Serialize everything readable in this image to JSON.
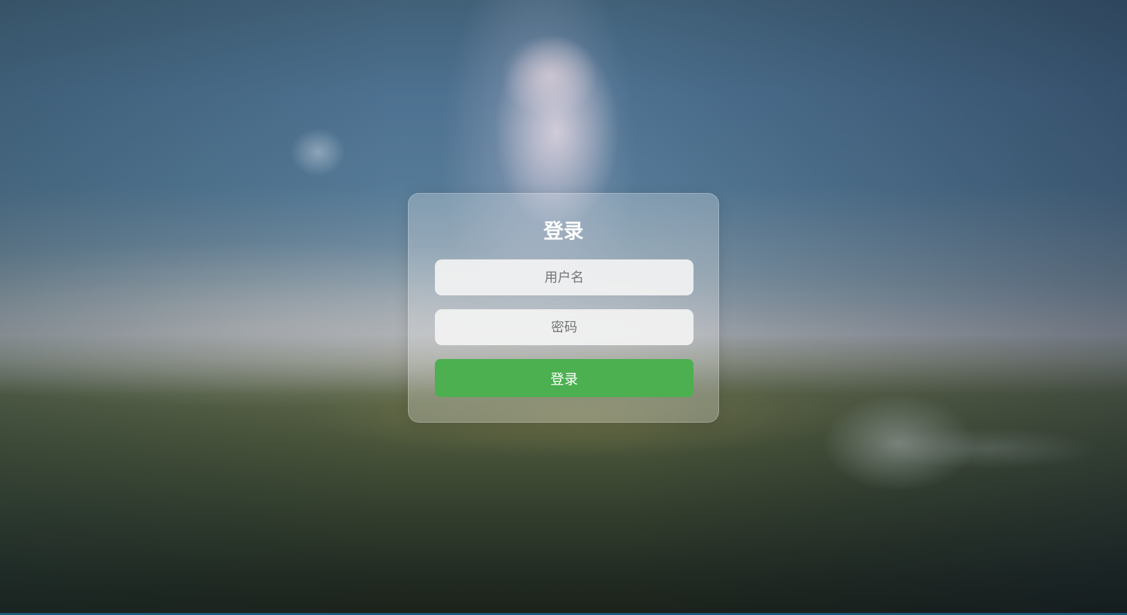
{
  "login": {
    "title": "登录",
    "username_placeholder": "用户名",
    "password_placeholder": "密码",
    "submit_label": "登录"
  },
  "colors": {
    "button": "#4caf50",
    "button_text": "#ffffff",
    "title": "#ffffff"
  }
}
